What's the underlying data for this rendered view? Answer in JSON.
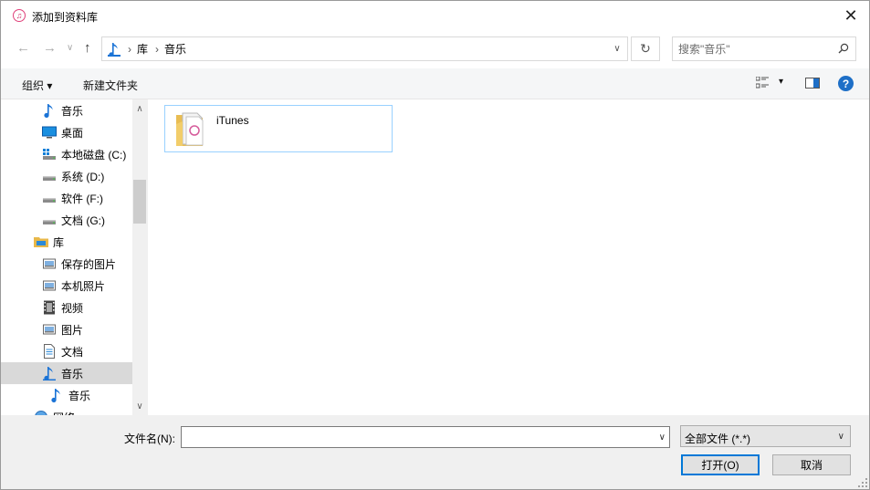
{
  "window": {
    "title": "添加到资料库",
    "close_glyph": "✕"
  },
  "nav": {
    "back_glyph": "←",
    "forward_glyph": "→",
    "recent_glyph": "∨",
    "up_glyph": "↑",
    "breadcrumb": [
      "库",
      "音乐"
    ],
    "refresh_glyph": "↻",
    "search_placeholder": "搜索\"音乐\""
  },
  "toolbar": {
    "organize": "组织 ▾",
    "new_folder": "新建文件夹",
    "view_dropdown": "▾",
    "help": "?"
  },
  "sidebar": {
    "items": [
      {
        "label": "音乐",
        "icon": "music-note-icon"
      },
      {
        "label": "桌面",
        "icon": "desktop-icon"
      },
      {
        "label": "本地磁盘 (C:)",
        "icon": "system-drive-icon"
      },
      {
        "label": "系统 (D:)",
        "icon": "drive-icon"
      },
      {
        "label": "软件 (F:)",
        "icon": "drive-icon"
      },
      {
        "label": "文档 (G:)",
        "icon": "drive-icon"
      },
      {
        "label": "库",
        "icon": "library-icon"
      },
      {
        "label": "保存的图片",
        "icon": "pictures-icon"
      },
      {
        "label": "本机照片",
        "icon": "pictures-icon"
      },
      {
        "label": "视频",
        "icon": "video-icon"
      },
      {
        "label": "图片",
        "icon": "pictures-icon"
      },
      {
        "label": "文档",
        "icon": "document-icon"
      },
      {
        "label": "音乐",
        "icon": "music-note-icon",
        "selected": true
      },
      {
        "label": "音乐",
        "icon": "music-note-icon"
      },
      {
        "label": "网络",
        "icon": "network-icon"
      }
    ]
  },
  "content": {
    "items": [
      {
        "label": "iTunes",
        "icon": "folder-icon"
      }
    ]
  },
  "bottom": {
    "filename_label": "文件名(N):",
    "filename_value": "",
    "filetype_value": "全部文件 (*.*)",
    "open_button": "打开(O)",
    "cancel_button": "取消"
  },
  "colors": {
    "accent": "#0078d7",
    "help": "#1e6fc7",
    "music_icon": "#1a73d6",
    "selection": "#d9d9d9"
  }
}
